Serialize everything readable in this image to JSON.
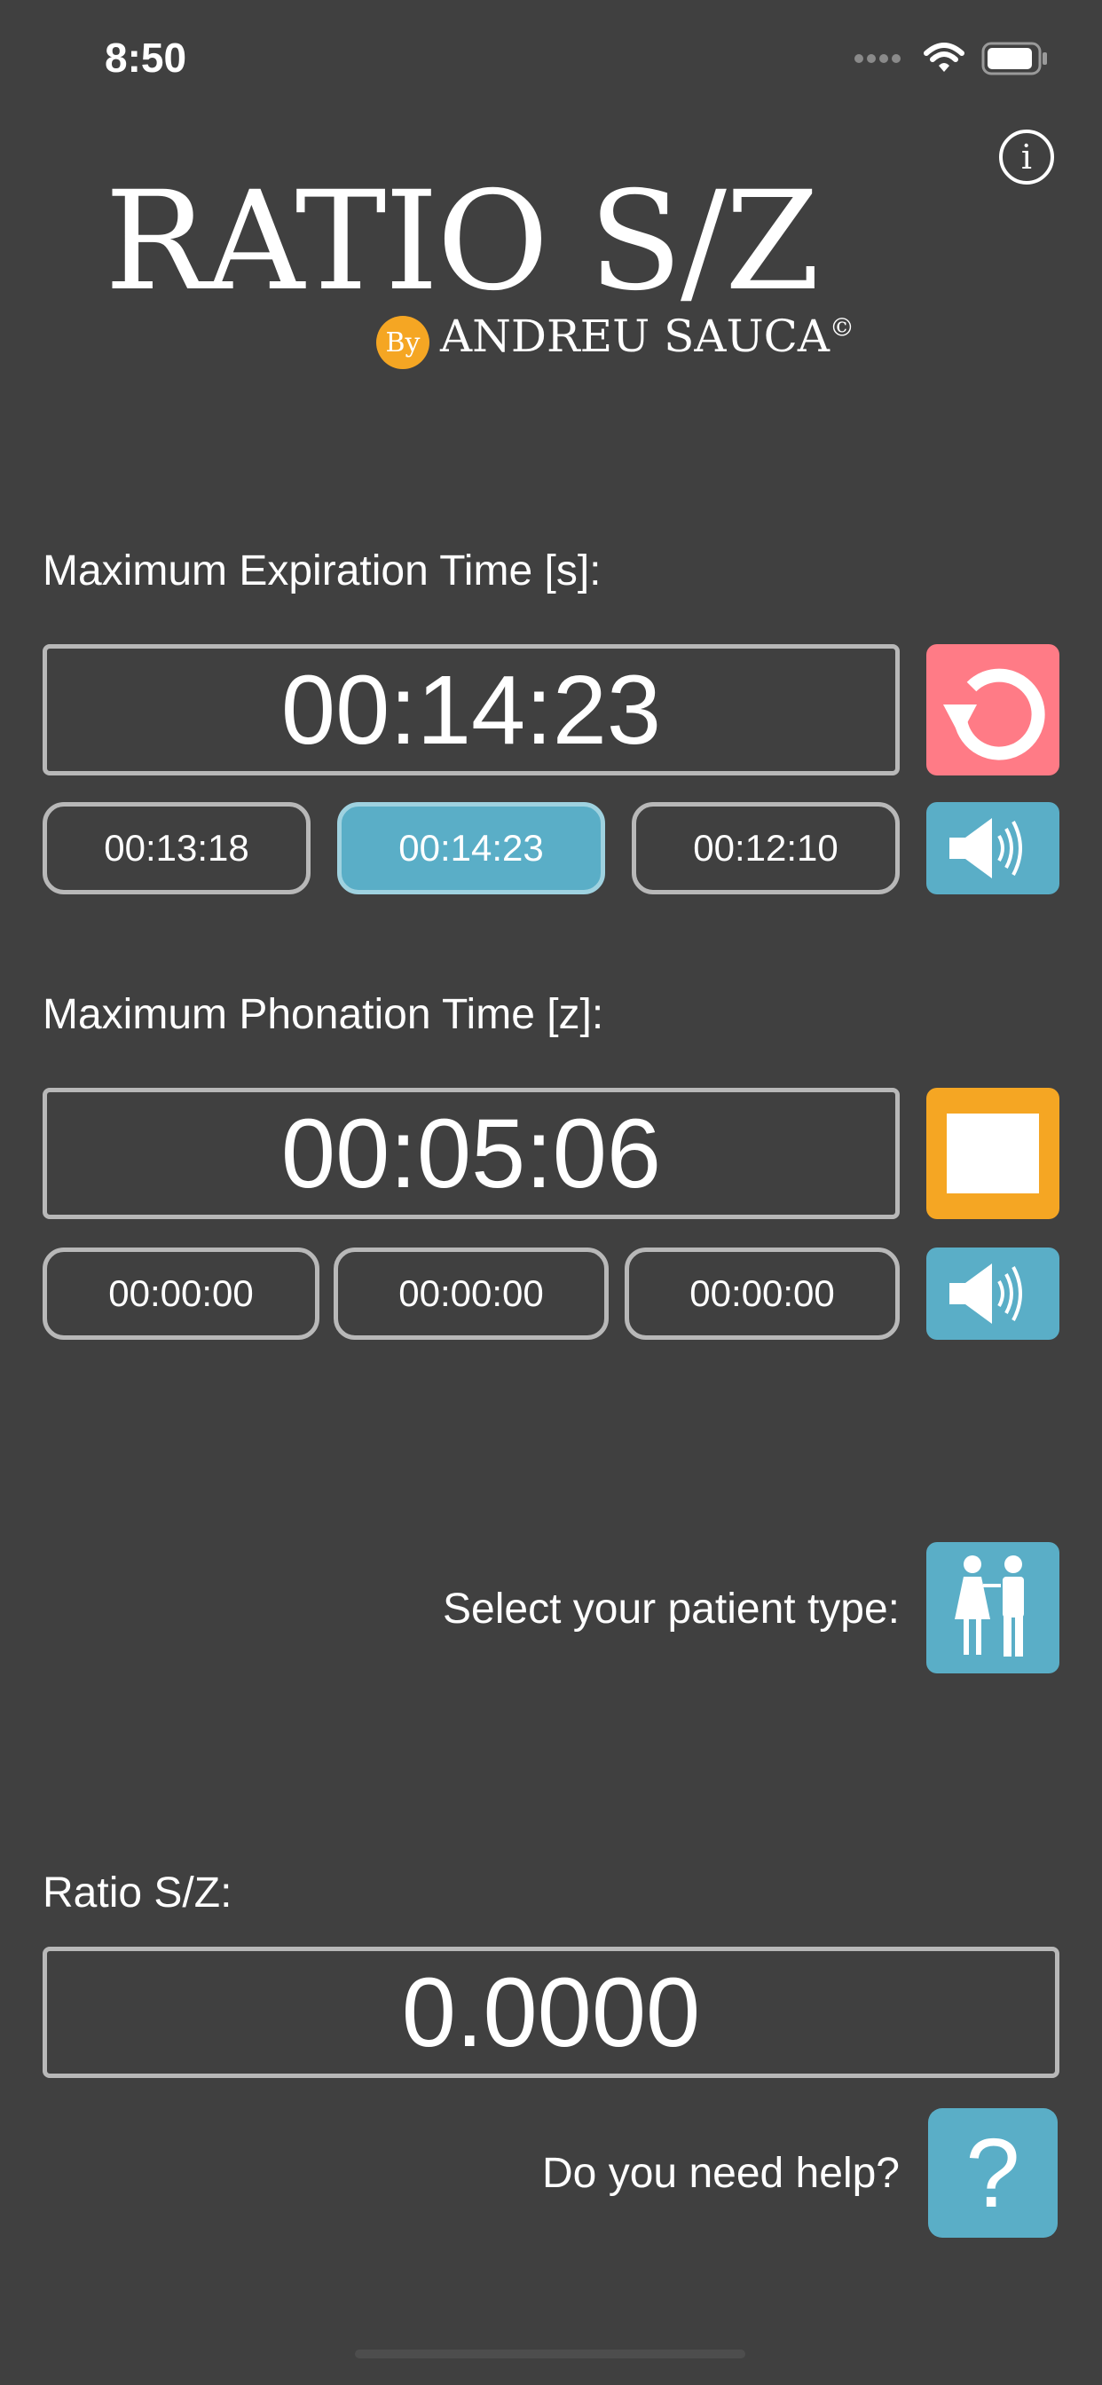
{
  "status_bar": {
    "time": "8:50"
  },
  "logo": {
    "title": "RATIO S/Z",
    "by": "By",
    "author": "ANDREU SAUCA",
    "copyright": "©"
  },
  "info": {
    "glyph": "i"
  },
  "expiration": {
    "label": "Maximum Expiration Time [s]:",
    "main_value": "00:14:23",
    "trials": [
      {
        "value": "00:13:18",
        "selected": false
      },
      {
        "value": "00:14:23",
        "selected": true
      },
      {
        "value": "00:12:10",
        "selected": false
      }
    ],
    "reset_button_color": "#ff7b86",
    "sound_button_color": "#5aaec7"
  },
  "phonation": {
    "label": "Maximum Phonation Time [z]:",
    "main_value": "00:05:06",
    "trials": [
      {
        "value": "00:00:00",
        "selected": false
      },
      {
        "value": "00:00:00",
        "selected": false
      },
      {
        "value": "00:00:00",
        "selected": false
      }
    ],
    "stop_button_color": "#f5a623",
    "sound_button_color": "#5aaec7"
  },
  "patient": {
    "label": "Select your patient type:",
    "icon": "couple-icon",
    "button_color": "#5aaec7"
  },
  "ratio": {
    "label": "Ratio S/Z:",
    "value": "0.0000"
  },
  "help": {
    "label": "Do you need help?",
    "glyph": "?",
    "button_color": "#5aaec7"
  },
  "colors": {
    "background": "#404040",
    "border": "#b8b8b8",
    "accent": "#5aaec7"
  }
}
